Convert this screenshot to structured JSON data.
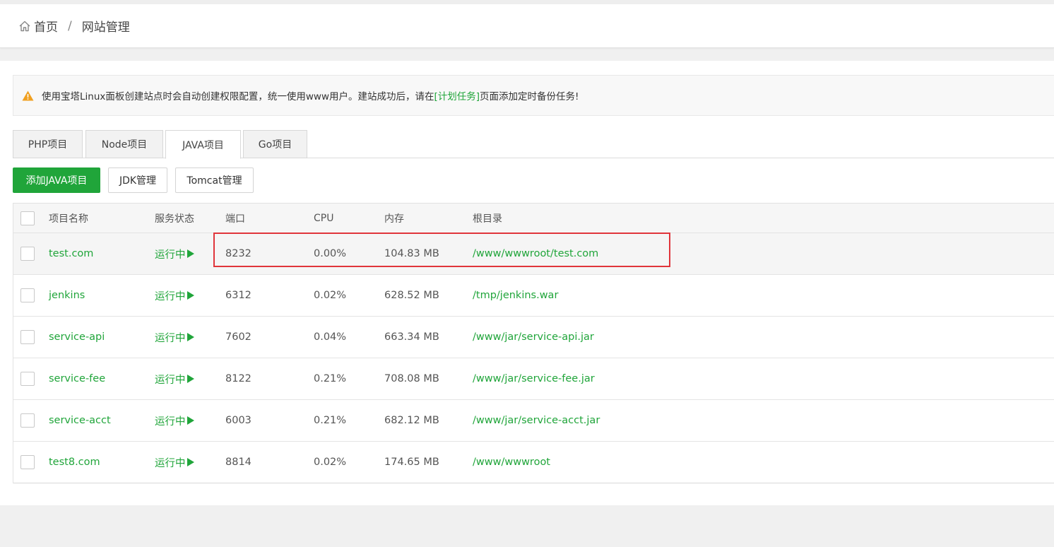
{
  "breadcrumb": {
    "home": "首页",
    "separator": "/",
    "current": "网站管理"
  },
  "notice": {
    "text_before": "使用宝塔Linux面板创建站点时会自动创建权限配置，统一使用www用户。建站成功后，请在",
    "link": "[计划任务]",
    "text_after": "页面添加定时备份任务!"
  },
  "tabs": [
    "PHP项目",
    "Node项目",
    "JAVA项目",
    "Go项目"
  ],
  "active_tab": "JAVA项目",
  "buttons": {
    "add": "添加JAVA项目",
    "jdk": "JDK管理",
    "tomcat": "Tomcat管理"
  },
  "table": {
    "headers": {
      "name": "项目名称",
      "status": "服务状态",
      "port": "端口",
      "cpu": "CPU",
      "mem": "内存",
      "root": "根目录"
    },
    "rows": [
      {
        "name": "test.com",
        "status": "运行中",
        "port": "8232",
        "cpu": "0.00%",
        "mem": "104.83 MB",
        "root": "/www/wwwroot/test.com"
      },
      {
        "name": "jenkins",
        "status": "运行中",
        "port": "6312",
        "cpu": "0.02%",
        "mem": "628.52 MB",
        "root": "/tmp/jenkins.war"
      },
      {
        "name": "service-api",
        "status": "运行中",
        "port": "7602",
        "cpu": "0.04%",
        "mem": "663.34 MB",
        "root": "/www/jar/service-api.jar"
      },
      {
        "name": "service-fee",
        "status": "运行中",
        "port": "8122",
        "cpu": "0.21%",
        "mem": "708.08 MB",
        "root": "/www/jar/service-fee.jar"
      },
      {
        "name": "service-acct",
        "status": "运行中",
        "port": "6003",
        "cpu": "0.21%",
        "mem": "682.12 MB",
        "root": "/www/jar/service-acct.jar"
      },
      {
        "name": "test8.com",
        "status": "运行中",
        "port": "8814",
        "cpu": "0.02%",
        "mem": "174.65 MB",
        "root": "/www/wwwroot"
      }
    ]
  },
  "colors": {
    "accent": "#20a53a",
    "highlight_box": "#e0353b",
    "warning": "#f0a020"
  },
  "icons": {
    "home": "home-icon",
    "warning": "warning-icon",
    "play": "play-icon"
  }
}
